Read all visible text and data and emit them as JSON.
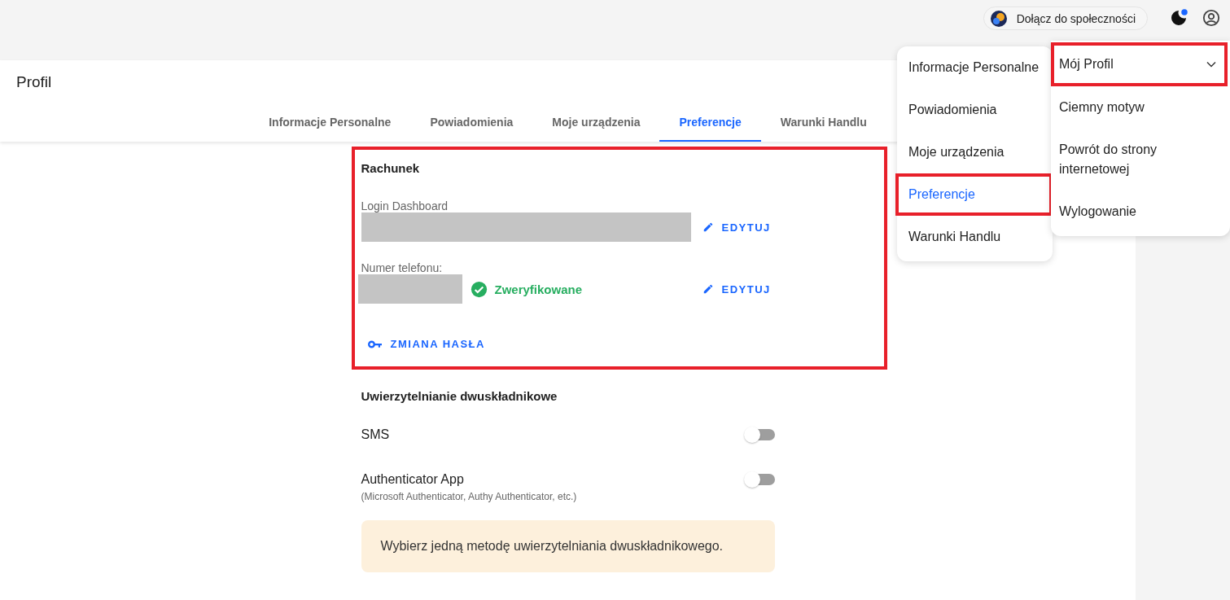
{
  "top_bar": {
    "community_button": "Dołącz do społeczności",
    "has_notification": true
  },
  "page": {
    "title": "Profil",
    "tabs": [
      {
        "label": "Informacje Personalne",
        "selected": false
      },
      {
        "label": "Powiadomienia",
        "selected": false
      },
      {
        "label": "Moje urządzenia",
        "selected": false
      },
      {
        "label": "Preferencje",
        "selected": true
      },
      {
        "label": "Warunki Handlu",
        "selected": false
      }
    ]
  },
  "account": {
    "title": "Rachunek",
    "login": {
      "label": "Login Dashboard",
      "edit": "EDYTUJ"
    },
    "phone": {
      "label": "Numer telefonu:",
      "verified": true,
      "status": "Zweryfikowane",
      "edit": "EDYTUJ"
    },
    "change_password": "ZMIANA HASŁA"
  },
  "two_factor": {
    "title": "Uwierzytelnianie dwuskładnikowe",
    "options": [
      {
        "label": "SMS",
        "on": false
      },
      {
        "label": "Authenticator App",
        "description": "(Microsoft Authenticator, Authy Authenticator, etc.)",
        "on": false
      }
    ],
    "notice": "Wybierz jedną metodę uwierzytelniania dwuskładnikowego."
  },
  "profile_menu": {
    "items": [
      {
        "label": "Informacje Personalne",
        "selected": false
      },
      {
        "label": "Powiadomienia",
        "selected": false
      },
      {
        "label": "Moje urządzenia",
        "selected": false
      },
      {
        "label": "Preferencje",
        "selected": true
      },
      {
        "label": "Warunki Handlu",
        "selected": false
      }
    ]
  },
  "account_menu": {
    "title": "Mój Profil",
    "expanded": true,
    "items": [
      {
        "label": "Ciemny motyw"
      },
      {
        "label": "Powrót do strony internetowej"
      },
      {
        "label": "Wylogowanie"
      }
    ]
  }
}
